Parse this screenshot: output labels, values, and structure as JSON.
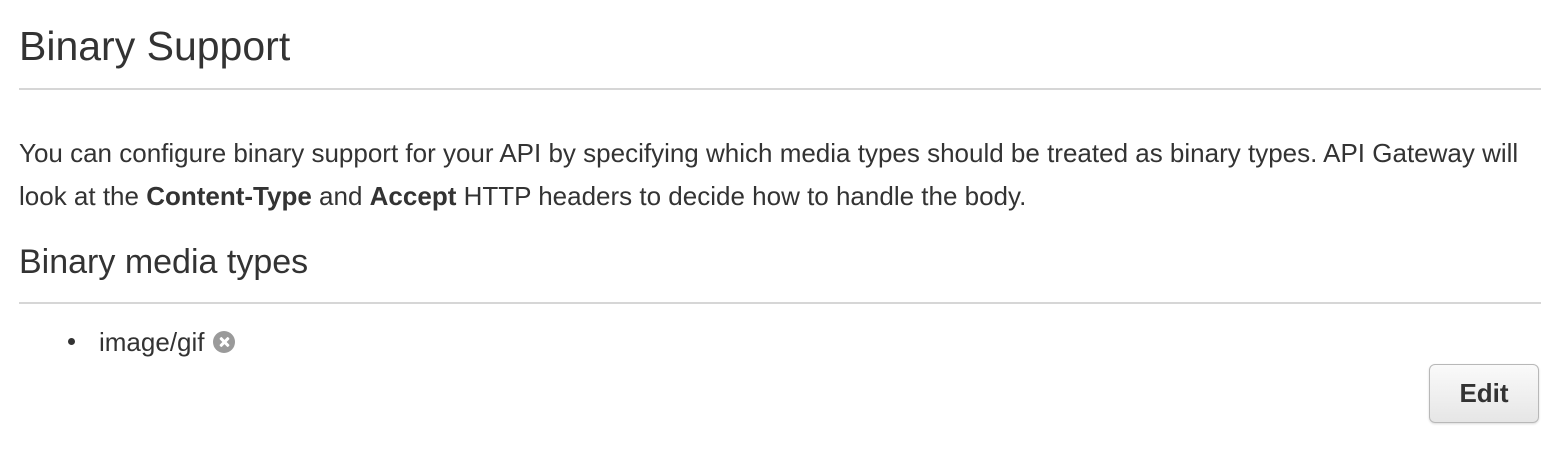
{
  "page": {
    "title": "Binary Support"
  },
  "description": {
    "part1": "You can configure binary support for your API by specifying which media types should be treated as binary types. API Gateway will look at the ",
    "bold1": "Content-Type",
    "part2": " and ",
    "bold2": "Accept",
    "part3": " HTTP headers to decide how to handle the body."
  },
  "media_types": {
    "title": "Binary media types",
    "items": [
      {
        "label": "image/gif",
        "remove_icon": "remove-circle-icon"
      }
    ]
  },
  "actions": {
    "edit_label": "Edit"
  },
  "colors": {
    "text": "#333333",
    "divider": "#d6d6d6",
    "remove_icon": "#9a9a9a"
  }
}
